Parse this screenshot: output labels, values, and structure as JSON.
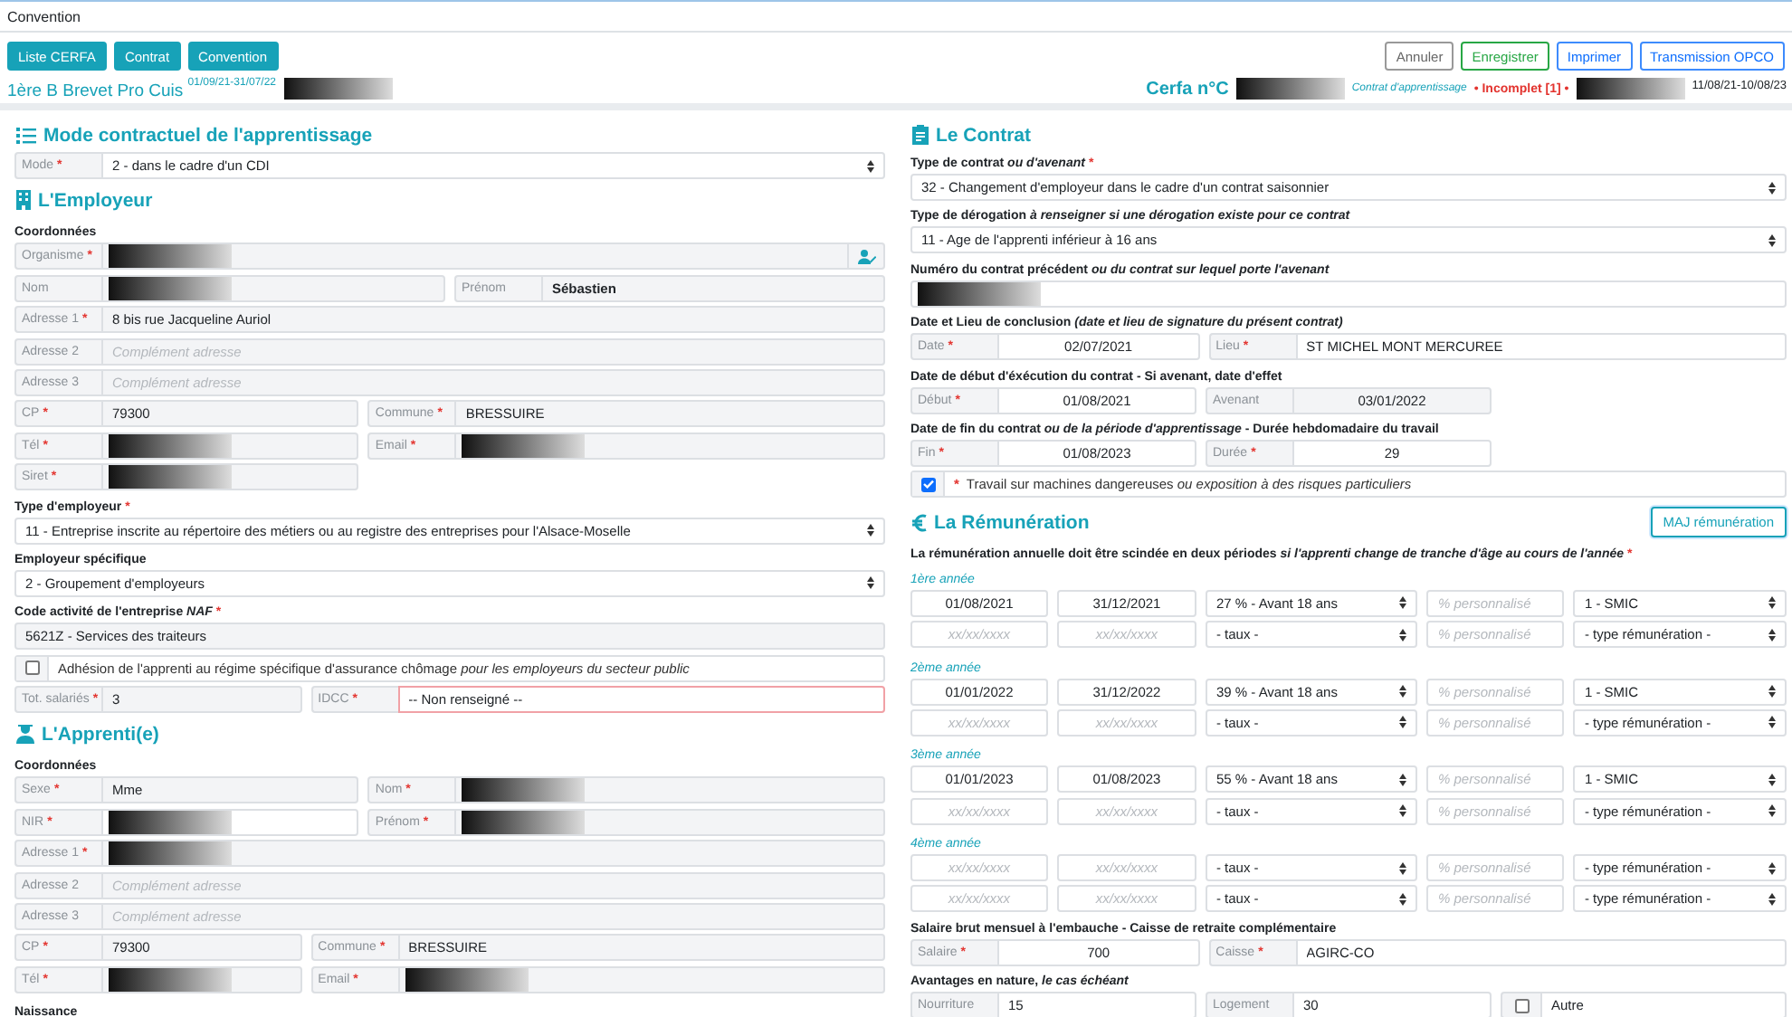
{
  "header": {
    "title": "Convention",
    "nav_buttons": [
      {
        "label": "Liste CERFA"
      },
      {
        "label": "Contrat"
      },
      {
        "label": "Convention"
      }
    ],
    "actions": [
      {
        "label": "Annuler",
        "kind": "default"
      },
      {
        "label": "Enregistrer",
        "kind": "success"
      },
      {
        "label": "Imprimer",
        "kind": "primary"
      },
      {
        "label": "Transmission OPCO",
        "kind": "primary"
      }
    ],
    "class_name": "1ère B Brevet Pro Cuis $^{01/09/21-31/07/22}$",
    "class_redacted": true,
    "cerfa_label": "Cerfa n°C",
    "cerfa_redacted": true,
    "contract_kind": "Contrat d'apprentissage",
    "status": "• Incomplet [1] •",
    "student_redacted": true,
    "dates": "11/08/21-10/08/23"
  },
  "columns": [
    {
      "sections": [
        {
          "title": "Mode contractuel de l'apprentissage",
          "rows": [
            {
              "kind": "full",
              "fields": [
                {
                  "label": "Mode",
                  "req": "*",
                  "kind": "select",
                  "value": "2 - dans le cadre d'un CDI"
                }
              ]
            }
          ]
        },
        {
          "title": "L'Employeur",
          "rows": [
            {
              "kind": "subheading",
              "text": "Coordonnées"
            },
            {
              "kind": "full",
              "fields": [
                {
                  "label": "Organisme",
                  "req": "*",
                  "kind": "redacted",
                  "readonly": true,
                  "picker": true
                }
              ]
            },
            {
              "kind": "half",
              "fields": [
                {
                  "label": "Nom",
                  "kind": "redacted",
                  "readonly": true
                },
                {
                  "label": "Prénom",
                  "kind": "text",
                  "value": "Sébastien",
                  "readonly": true,
                  "bold": true
                }
              ]
            },
            {
              "kind": "full",
              "fields": [
                {
                  "label": "Adresse 1",
                  "req": "*",
                  "kind": "text",
                  "value": "8 bis rue Jacqueline Auriol",
                  "readonly": true
                }
              ]
            },
            {
              "kind": "full",
              "fields": [
                {
                  "label": "Adresse 2",
                  "kind": "text",
                  "placeholder": "Complément adresse",
                  "readonly": true
                }
              ]
            },
            {
              "kind": "full",
              "fields": [
                {
                  "label": "Adresse 3",
                  "kind": "text",
                  "placeholder": "Complément adresse",
                  "readonly": true
                }
              ]
            },
            {
              "kind": "pair",
              "fields": [
                {
                  "label": "CP",
                  "req": "*",
                  "kind": "text",
                  "value": "79300",
                  "readonly": true
                },
                {
                  "label": "Commune",
                  "req": "*",
                  "kind": "text",
                  "value": "BRESSUIRE",
                  "readonly": true
                }
              ]
            },
            {
              "kind": "pair",
              "fields": [
                {
                  "label": "Tél",
                  "req": "*",
                  "kind": "redacted",
                  "readonly": true
                },
                {
                  "label": "Email",
                  "req": "*",
                  "kind": "redacted",
                  "readonly": true
                }
              ]
            },
            {
              "kind": "pair",
              "fields": [
                {
                  "label": "Siret",
                  "req": "*",
                  "kind": "redacted",
                  "readonly": true
                }
              ]
            },
            {
              "kind": "caption",
              "text": "Type d'employeur",
              "req": "*"
            },
            {
              "kind": "full",
              "fields": [
                {
                  "kind": "select",
                  "value": "11 - Entreprise inscrite au répertoire des métiers ou au registre des entreprises pour l'Alsace-Moselle"
                }
              ]
            },
            {
              "kind": "caption",
              "text": "Employeur spécifique"
            },
            {
              "kind": "full",
              "fields": [
                {
                  "kind": "select",
                  "value": "2 - Groupement d'employeurs"
                }
              ]
            },
            {
              "kind": "caption",
              "text": "Code activité de l'entreprise *NAF*",
              "req": "*"
            },
            {
              "kind": "full",
              "fields": [
                {
                  "kind": "text",
                  "value": "5621Z - Services des traiteurs",
                  "readonly": true
                }
              ]
            },
            {
              "kind": "checkbox",
              "checked": false,
              "text": "Adhésion de l'apprenti au régime spécifique d'assurance chômage *pour les employeurs du secteur public*"
            },
            {
              "kind": "third",
              "fields": [
                {
                  "label": "Tot. salariés",
                  "req": "*",
                  "kind": "text",
                  "value": "3",
                  "readonly": true
                },
                {
                  "label": "IDCC",
                  "req": "*",
                  "kind": "text",
                  "value": "-- Non renseigné --",
                  "invalid": true
                }
              ]
            }
          ]
        },
        {
          "title": "L'Apprenti(e)",
          "rows": [
            {
              "kind": "subheading",
              "text": "Coordonnées"
            },
            {
              "kind": "pair",
              "fields": [
                {
                  "label": "Sexe",
                  "req": "*",
                  "kind": "text",
                  "value": "Mme",
                  "readonly": true
                },
                {
                  "label": "Nom",
                  "req": "*",
                  "kind": "redacted",
                  "readonly": true
                }
              ]
            },
            {
              "kind": "pair",
              "fields": [
                {
                  "label": "NIR",
                  "req": "*",
                  "kind": "redacted"
                },
                {
                  "label": "Prénom",
                  "req": "*",
                  "kind": "redacted",
                  "readonly": true
                }
              ]
            },
            {
              "kind": "full",
              "fields": [
                {
                  "label": "Adresse 1",
                  "req": "*",
                  "kind": "redacted",
                  "readonly": true
                }
              ]
            },
            {
              "kind": "full",
              "fields": [
                {
                  "label": "Adresse 2",
                  "kind": "text",
                  "placeholder": "Complément adresse",
                  "readonly": true
                }
              ]
            },
            {
              "kind": "full",
              "fields": [
                {
                  "label": "Adresse 3",
                  "kind": "text",
                  "placeholder": "Complément adresse",
                  "readonly": true
                }
              ]
            },
            {
              "kind": "third",
              "fields": [
                {
                  "label": "CP",
                  "req": "*",
                  "kind": "text",
                  "value": "79300",
                  "readonly": true
                },
                {
                  "label": "Commune",
                  "req": "*",
                  "kind": "text",
                  "value": "BRESSUIRE",
                  "readonly": true
                }
              ]
            },
            {
              "kind": "third",
              "fields": [
                {
                  "label": "Tél",
                  "req": "*",
                  "kind": "redacted",
                  "readonly": true
                },
                {
                  "label": "Email",
                  "req": "*",
                  "kind": "redacted",
                  "readonly": true
                }
              ]
            },
            {
              "kind": "subheading",
              "text": "Naissance"
            }
          ]
        }
      ]
    },
    {
      "sections": [
        {
          "title": "Le Contrat",
          "rows": [
            {
              "kind": "caption",
              "text": "Type de contrat *ou d'avenant*",
              "req": "*"
            },
            {
              "kind": "full",
              "fields": [
                {
                  "kind": "select",
                  "value": "32 - Changement d'employeur dans le cadre d'un contrat saisonnier"
                }
              ]
            },
            {
              "kind": "caption",
              "text": "Type de dérogation *à renseigner si une dérogation existe pour ce contrat*"
            },
            {
              "kind": "full",
              "fields": [
                {
                  "kind": "select",
                  "value": "11 - Age de l'apprenti inférieur à 16 ans"
                }
              ]
            },
            {
              "kind": "caption",
              "text": "Numéro du contrat précédent *ou du contrat sur lequel porte l'avenant*"
            },
            {
              "kind": "full",
              "fields": [
                {
                  "kind": "redacted"
                }
              ]
            },
            {
              "kind": "caption",
              "text": "Date et Lieu de conclusion *(date et lieu de signature du présent contrat)*"
            },
            {
              "kind": "third",
              "fields": [
                {
                  "label": "Date",
                  "req": "*",
                  "kind": "date",
                  "value": "02/07/2021"
                },
                {
                  "label": "Lieu",
                  "req": "*",
                  "kind": "text",
                  "value": "ST MICHEL MONT MERCUREE"
                }
              ]
            },
            {
              "kind": "caption",
              "text": "Date de début d'éxécution du contrat - Si avenant, date d'effet"
            },
            {
              "kind": "thirds",
              "fields": [
                {
                  "label": "Début",
                  "req": "*",
                  "kind": "date",
                  "value": "01/08/2021"
                },
                {
                  "label": "Avenant",
                  "kind": "date",
                  "value": "03/01/2022",
                  "readonly": true
                }
              ]
            },
            {
              "kind": "caption",
              "text": "Date de fin du contrat *ou de la période d'apprentissage* - Durée hebdomadaire du travail"
            },
            {
              "kind": "thirds",
              "fields": [
                {
                  "label": "Fin",
                  "req": "*",
                  "kind": "date",
                  "value": "01/08/2023"
                },
                {
                  "label": "Durée",
                  "req": "*",
                  "kind": "date",
                  "value": "29"
                }
              ]
            },
            {
              "kind": "checkbox",
              "checked": true,
              "req": "*",
              "text": "Travail sur machines dangereuses *ou exposition à des risques particuliers*"
            }
          ]
        },
        {
          "title": "La Rémunération",
          "action": {
            "label": "MAJ rémunération"
          },
          "rows": [
            {
              "kind": "caption",
              "text": "La rémunération annuelle doit être scindée en deux périodes *si l'apprenti change de tranche d'âge au cours de l'année*",
              "req": "*"
            },
            {
              "kind": "year",
              "text": "1ère année"
            },
            {
              "kind": "periods",
              "fields": [
                {
                  "kind": "date",
                  "value": "01/08/2021"
                },
                {
                  "kind": "date",
                  "value": "31/12/2021"
                },
                {
                  "kind": "select",
                  "value": "27 % - Avant 18 ans"
                },
                {
                  "kind": "text",
                  "placeholder": "% personnalisé"
                },
                {
                  "kind": "select",
                  "value": "1 - SMIC"
                }
              ]
            },
            {
              "kind": "periods",
              "fields": [
                {
                  "kind": "date",
                  "placeholder": "xx/xx/xxxx"
                },
                {
                  "kind": "date",
                  "placeholder": "xx/xx/xxxx"
                },
                {
                  "kind": "select",
                  "value": "- taux -"
                },
                {
                  "kind": "text",
                  "placeholder": "% personnalisé"
                },
                {
                  "kind": "select",
                  "value": "- type rémunération -"
                }
              ]
            },
            {
              "kind": "year",
              "text": "2ème année"
            },
            {
              "kind": "periods",
              "fields": [
                {
                  "kind": "date",
                  "value": "01/01/2022"
                },
                {
                  "kind": "date",
                  "value": "31/12/2022"
                },
                {
                  "kind": "select",
                  "value": "39 % - Avant 18 ans"
                },
                {
                  "kind": "text",
                  "placeholder": "% personnalisé"
                },
                {
                  "kind": "select",
                  "value": "1 - SMIC"
                }
              ]
            },
            {
              "kind": "periods",
              "fields": [
                {
                  "kind": "date",
                  "placeholder": "xx/xx/xxxx"
                },
                {
                  "kind": "date",
                  "placeholder": "xx/xx/xxxx"
                },
                {
                  "kind": "select",
                  "value": "- taux -"
                },
                {
                  "kind": "text",
                  "placeholder": "% personnalisé"
                },
                {
                  "kind": "select",
                  "value": "- type rémunération -"
                }
              ]
            },
            {
              "kind": "year",
              "text": "3ème année"
            },
            {
              "kind": "periods",
              "fields": [
                {
                  "kind": "date",
                  "value": "01/01/2023"
                },
                {
                  "kind": "date",
                  "value": "01/08/2023"
                },
                {
                  "kind": "select",
                  "value": "55 % - Avant 18 ans"
                },
                {
                  "kind": "text",
                  "placeholder": "% personnalisé"
                },
                {
                  "kind": "select",
                  "value": "1 - SMIC"
                }
              ]
            },
            {
              "kind": "periods",
              "fields": [
                {
                  "kind": "date",
                  "placeholder": "xx/xx/xxxx"
                },
                {
                  "kind": "date",
                  "placeholder": "xx/xx/xxxx"
                },
                {
                  "kind": "select",
                  "value": "- taux -"
                },
                {
                  "kind": "text",
                  "placeholder": "% personnalisé"
                },
                {
                  "kind": "select",
                  "value": "- type rémunération -"
                }
              ]
            },
            {
              "kind": "year",
              "text": "4ème année"
            },
            {
              "kind": "periods",
              "fields": [
                {
                  "kind": "date",
                  "placeholder": "xx/xx/xxxx"
                },
                {
                  "kind": "date",
                  "placeholder": "xx/xx/xxxx"
                },
                {
                  "kind": "select",
                  "value": "- taux -"
                },
                {
                  "kind": "text",
                  "placeholder": "% personnalisé"
                },
                {
                  "kind": "select",
                  "value": "- type rémunération -"
                }
              ]
            },
            {
              "kind": "periods",
              "fields": [
                {
                  "kind": "date",
                  "placeholder": "xx/xx/xxxx"
                },
                {
                  "kind": "date",
                  "placeholder": "xx/xx/xxxx"
                },
                {
                  "kind": "select",
                  "value": "- taux -"
                },
                {
                  "kind": "text",
                  "placeholder": "% personnalisé"
                },
                {
                  "kind": "select",
                  "value": "- type rémunération -"
                }
              ]
            },
            {
              "kind": "caption",
              "text": "Salaire brut mensuel à l'embauche - Caisse de retraite complémentaire"
            },
            {
              "kind": "third",
              "fields": [
                {
                  "label": "Salaire",
                  "req": "*",
                  "kind": "date",
                  "value": "700"
                },
                {
                  "label": "Caisse",
                  "req": "*",
                  "kind": "text",
                  "value": "AGIRC-CO"
                }
              ]
            },
            {
              "kind": "caption",
              "text": "Avantages en nature, *le cas échéant*"
            },
            {
              "kind": "thirds",
              "fields": [
                {
                  "label": "Nourriture",
                  "kind": "text",
                  "value": "15"
                },
                {
                  "label": "Logement",
                  "kind": "text",
                  "value": "30"
                },
                {
                  "kind": "checkbox",
                  "checked": false,
                  "value": "Autre"
                }
              ]
            }
          ]
        }
      ]
    }
  ]
}
